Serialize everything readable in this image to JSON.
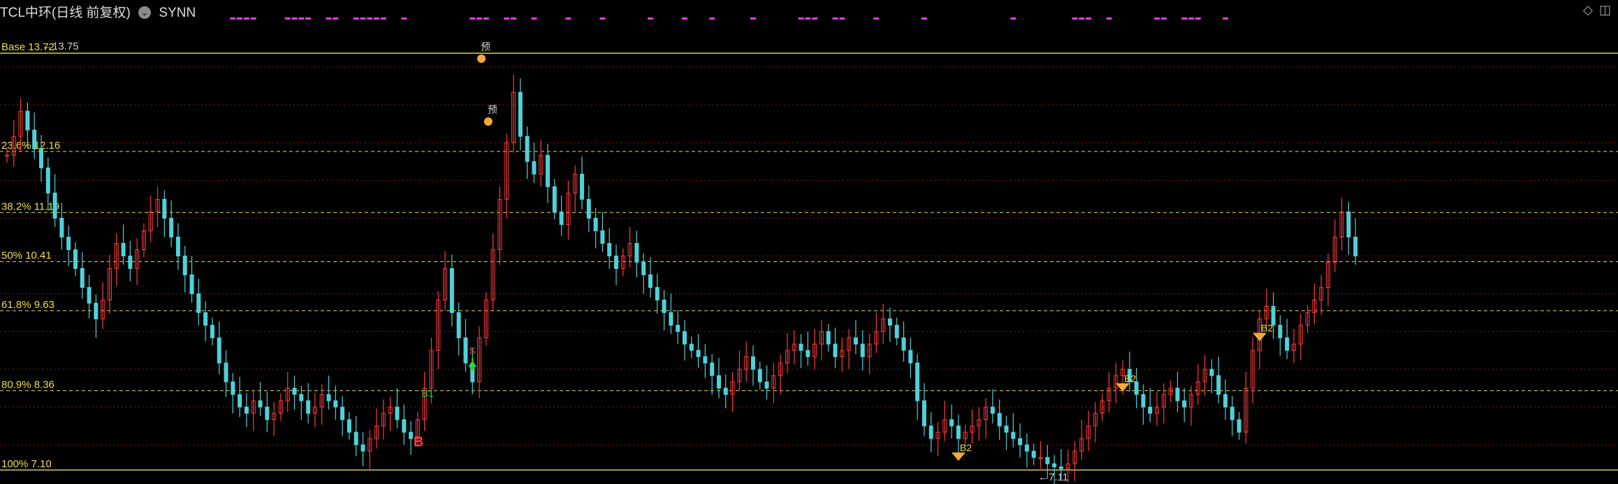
{
  "header": {
    "title": "TCL中环(日线 前复权)",
    "indicator": "SYNN",
    "diamond_icon": "diamond-icon",
    "panel_icon": "panel-toggle-icon"
  },
  "colors": {
    "up": "#ff3b3b",
    "down": "#4fd1d9",
    "fib": "#e8e04a",
    "grid": "#8b1a1a",
    "signal": "#e040e0",
    "arrow": "#21d421",
    "sell": "#ff3b3b",
    "marker": "#f4a93a"
  },
  "chart_data": {
    "type": "candlestick",
    "ylim": [
      7.0,
      13.9
    ],
    "fib_levels": [
      {
        "label": "Base 13.72",
        "value": 13.72
      },
      {
        "label": "23.6% 12.16",
        "value": 12.16
      },
      {
        "label": "38.2% 11.19",
        "value": 11.19
      },
      {
        "label": "50% 10.41",
        "value": 10.41
      },
      {
        "label": "61.8% 9.63",
        "value": 9.63
      },
      {
        "label": "80.9% 8.36",
        "value": 8.36
      },
      {
        "label": "100% 7.10",
        "value": 7.1
      }
    ],
    "extremes": {
      "high_label": "13.75",
      "low_label": "7.11"
    },
    "closes": [
      12.1,
      12.4,
      12.8,
      12.5,
      12.2,
      11.9,
      11.5,
      11.1,
      10.8,
      10.6,
      10.3,
      10.0,
      9.75,
      9.5,
      9.8,
      10.3,
      10.7,
      10.5,
      10.3,
      10.6,
      10.9,
      11.2,
      11.4,
      11.1,
      10.8,
      10.5,
      10.2,
      9.9,
      9.6,
      9.4,
      9.2,
      8.8,
      8.5,
      8.3,
      8.1,
      8.0,
      8.2,
      8.1,
      7.9,
      8.0,
      8.2,
      8.4,
      8.3,
      8.2,
      8.0,
      8.1,
      8.3,
      8.2,
      8.1,
      7.9,
      7.7,
      7.5,
      7.4,
      7.6,
      7.8,
      8.0,
      8.1,
      7.9,
      7.7,
      7.6,
      7.9,
      8.4,
      9.0,
      9.8,
      10.3,
      9.6,
      9.2,
      8.8,
      8.5,
      9.2,
      9.8,
      10.6,
      11.4,
      12.3,
      13.1,
      12.4,
      12.0,
      11.8,
      12.1,
      11.6,
      11.2,
      11.0,
      11.5,
      11.8,
      11.4,
      11.1,
      10.9,
      10.7,
      10.5,
      10.3,
      10.5,
      10.7,
      10.4,
      10.2,
      10.0,
      9.8,
      9.6,
      9.4,
      9.3,
      9.1,
      9.0,
      8.9,
      8.8,
      8.6,
      8.4,
      8.3,
      8.5,
      8.7,
      8.9,
      8.7,
      8.5,
      8.4,
      8.6,
      8.8,
      9.0,
      9.1,
      9.0,
      8.9,
      9.1,
      9.3,
      9.1,
      8.9,
      9.0,
      9.2,
      9.1,
      8.9,
      9.1,
      9.3,
      9.5,
      9.4,
      9.2,
      9.0,
      8.8,
      8.2,
      7.8,
      7.6,
      7.7,
      7.9,
      7.8,
      7.6,
      7.7,
      7.8,
      7.9,
      8.1,
      8.0,
      7.8,
      7.7,
      7.6,
      7.5,
      7.4,
      7.3,
      7.3,
      7.2,
      7.15,
      7.12,
      7.2,
      7.4,
      7.6,
      7.8,
      8.0,
      8.2,
      8.4,
      8.6,
      8.7,
      8.5,
      8.3,
      8.1,
      8.0,
      8.1,
      8.3,
      8.4,
      8.2,
      8.1,
      8.3,
      8.5,
      8.7,
      8.6,
      8.3,
      8.1,
      7.9,
      7.7,
      8.4,
      9.0,
      9.5,
      9.7,
      9.4,
      9.2,
      9.0,
      9.1,
      9.4,
      9.6,
      9.8,
      10.0,
      10.4,
      10.8,
      11.2,
      10.8,
      10.5
    ],
    "signals": [
      {
        "label": "B",
        "bar": 60,
        "kind": "buy"
      },
      {
        "label": "B1",
        "bar": 61,
        "kind": "buy1"
      },
      {
        "label": "S",
        "bar": 68,
        "kind": "sell"
      },
      {
        "label": "B2",
        "bar": 139,
        "kind": "buy2"
      },
      {
        "label": "B2",
        "bar": 163,
        "kind": "buy2"
      },
      {
        "label": "B2",
        "bar": 183,
        "kind": "buy2"
      },
      {
        "label": "S",
        "bar": 203,
        "kind": "sell"
      },
      {
        "label": "预",
        "bar": 69,
        "kind": "warn"
      },
      {
        "label": "预",
        "bar": 70,
        "kind": "warn"
      }
    ],
    "top_dashes": [
      33,
      34,
      35,
      36,
      41,
      42,
      43,
      44,
      47,
      48,
      51,
      52,
      53,
      54,
      55,
      58,
      68,
      69,
      70,
      73,
      74,
      77,
      82,
      87,
      94,
      99,
      103,
      109,
      116,
      117,
      118,
      121,
      122,
      127,
      134,
      147,
      156,
      157,
      158,
      161,
      168,
      169,
      172,
      173,
      174,
      178
    ]
  }
}
